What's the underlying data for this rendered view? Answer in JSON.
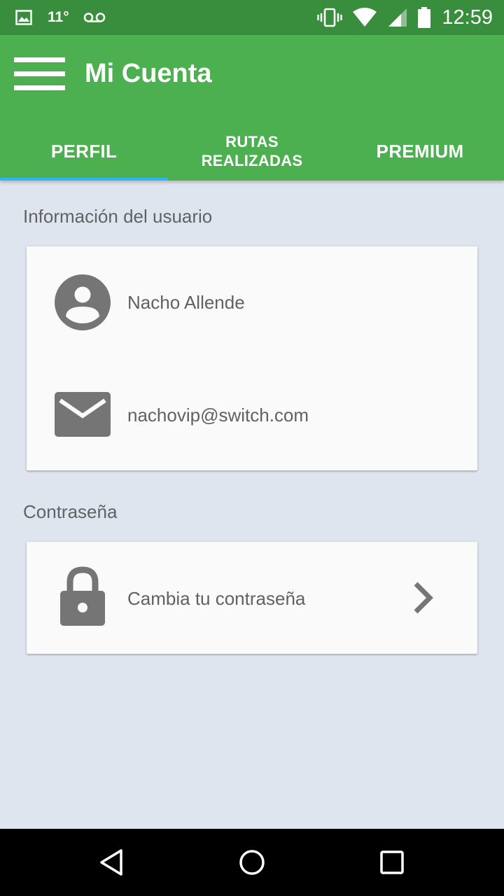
{
  "status_bar": {
    "temperature": "11°",
    "time": "12:59",
    "icons": [
      "image-icon",
      "voicemail-icon",
      "vibrate-icon",
      "wifi-icon",
      "signal-icon",
      "battery-icon"
    ]
  },
  "app_bar": {
    "title": "Mi Cuenta",
    "menu_icon": "hamburger-menu-icon",
    "color": "#4caf50"
  },
  "tabs": [
    {
      "label": "PERFIL",
      "selected": true
    },
    {
      "label": "RUTAS\nREALIZADAS",
      "selected": false
    },
    {
      "label": "PREMIUM",
      "selected": false
    }
  ],
  "tab_indicator_color": "#29b6f6",
  "user_info": {
    "section_title": "Información del usuario",
    "name": "Nacho Allende",
    "name_icon": "account-circle-icon",
    "email": "nachovip@switch.com",
    "email_icon": "mail-icon"
  },
  "password": {
    "section_title": "Contraseña",
    "action_label": "Cambia tu contraseña",
    "action_icon": "lock-icon",
    "chevron_icon": "chevron-right-icon"
  },
  "nav_bar": {
    "buttons": [
      "back-icon",
      "home-icon",
      "recents-icon"
    ]
  }
}
